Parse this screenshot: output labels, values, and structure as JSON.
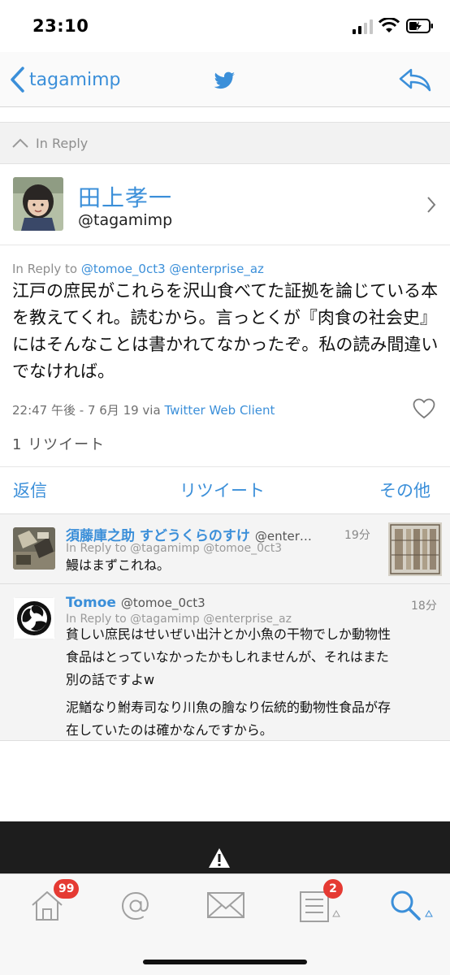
{
  "status_bar": {
    "time": "23:10"
  },
  "nav": {
    "back_label": "tagamimp"
  },
  "in_reply_bar": {
    "label": "In Reply"
  },
  "profile": {
    "name": "田上孝一",
    "handle": "@tagamimp"
  },
  "tweet": {
    "in_reply_prefix": "In Reply to ",
    "in_reply_users": "@tomoe_0ct3 @enterprise_az",
    "text": "江戸の庶民がこれらを沢山食べてた証拠を論じている本を教えてくれ。読むから。言っとくが『肉食の社会史』にはそんなことは書かれてなかったぞ。私の読み間違いでなければ。",
    "time": "22:47 午後 - 7 6月 19 via ",
    "client": "Twitter Web Client",
    "retweets": "1 リツイート"
  },
  "actions": {
    "reply": "返信",
    "retweet": "リツイート",
    "more": "その他"
  },
  "replies": [
    {
      "name": "須藤庫之助 すどうくらのすけ",
      "handle": "@enter…",
      "time": "19分",
      "in_reply": "In Reply to @tagamimp @tomoe_0ct3",
      "text": "鰻はまずこれね。"
    },
    {
      "name": "Tomoe",
      "handle": "@tomoe_0ct3",
      "time": "18分",
      "in_reply": "In Reply to @tagamimp @enterprise_az",
      "text_line1": "貧しい庶民はせいぜい出汁とか小魚の干物でしか動物性",
      "text_line2": "食品はとっていなかったかもしれませんが、それはまた",
      "text_line3": "別の話ですよw",
      "text_line4": "泥鰌なり鮒寿司なり川魚の膾なり伝統的動物性食品が存",
      "text_line5": "在していたのは確かなんですから。"
    }
  ],
  "tab_bar": {
    "home_badge": "99",
    "lists_badge": "2"
  },
  "colors": {
    "accent": "#3b8fd9",
    "badge": "#e53a33"
  }
}
